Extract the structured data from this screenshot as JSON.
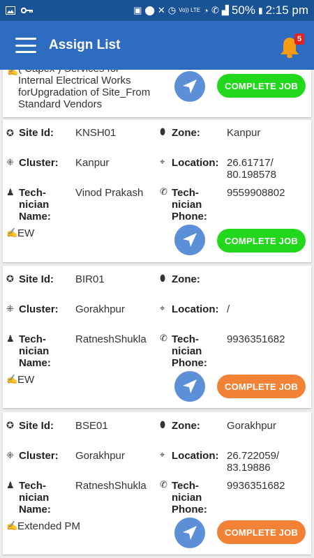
{
  "statusbar": {
    "icons": [
      "image-icon",
      "key-icon",
      "battery-saver-icon",
      "location-icon",
      "silent-icon",
      "alarm-icon",
      "volte-icon",
      "wifi-icon",
      "phone-icon",
      "signal-icon"
    ],
    "volte": "Vo)) LTE",
    "battery": "50%",
    "time": "2:15 pm"
  },
  "appbar": {
    "title": "Assign List",
    "notification_count": "5"
  },
  "labels": {
    "site_id": "Site Id:",
    "zone": "Zone:",
    "cluster": "Cluster:",
    "location": "Location:",
    "tech_name": "Tech-\nnician\nName:",
    "tech_phone": "Tech-\nnician\nPhone:",
    "complete_job": "COMPLETE JOB"
  },
  "colors": {
    "primary": "#2e6cc2",
    "status_bar": "#1a5296",
    "green_button": "#21d81d",
    "orange_button": "#f28235",
    "nav_button": "#5b8fd6",
    "badge": "#e4221b"
  },
  "cards": [
    {
      "description": "( Capex ) Services for\nInternal Electrical Works\nforUpgradation of  Site_From\nStandard Vendors",
      "button_color": "green"
    },
    {
      "site_id": "KNSH01",
      "zone": "Kanpur",
      "cluster": "Kanpur",
      "location": "26.61717/\n80.198578",
      "technician_name": "Vinod Prakash",
      "technician_phone": "9559908802",
      "job_type": "EW",
      "button_color": "green"
    },
    {
      "site_id": "BIR01",
      "zone": "",
      "cluster": "Gorakhpur",
      "location": "/",
      "technician_name": "RatneshShukla",
      "technician_phone": "9936351682",
      "job_type": "EW",
      "button_color": "orange"
    },
    {
      "site_id": "BSE01",
      "zone": "Gorakhpur",
      "cluster": "Gorakhpur",
      "location": "26.722059/\n83.19886",
      "technician_name": "RatneshShukla",
      "technician_phone": "9936351682",
      "job_type": "Extended PM",
      "button_color": "orange"
    }
  ]
}
